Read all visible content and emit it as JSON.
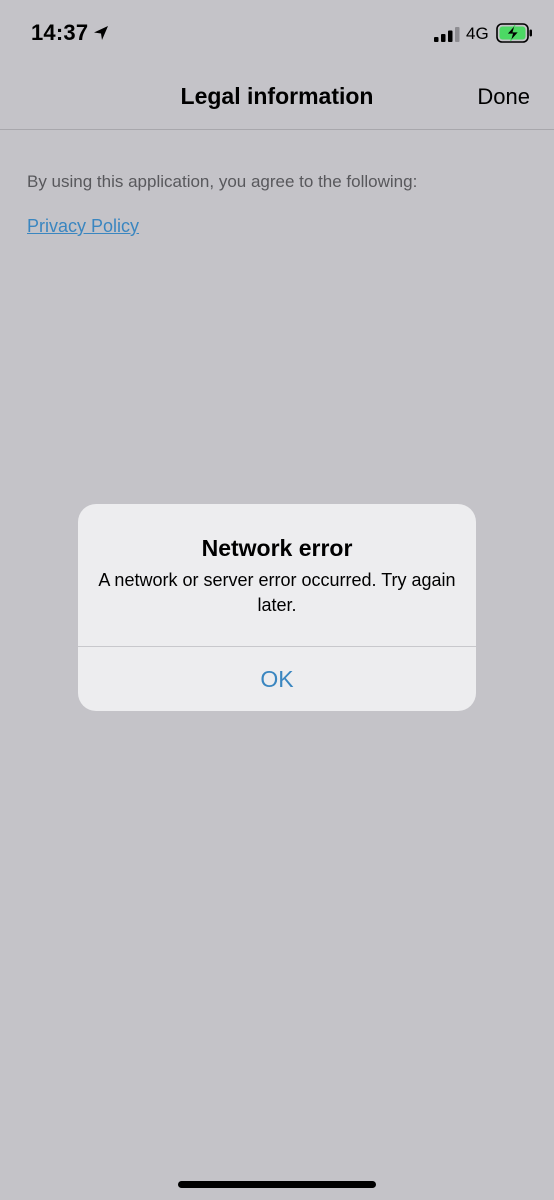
{
  "status_bar": {
    "time": "14:37",
    "network": "4G",
    "icons": [
      "location-arrow-icon",
      "signal-icon",
      "battery-charging-icon"
    ]
  },
  "nav": {
    "title": "Legal information",
    "done_label": "Done"
  },
  "content": {
    "intro": "By using this application, you agree to the following:",
    "privacy_link": "Privacy Policy"
  },
  "alert": {
    "title": "Network error",
    "message": "A network or server error occurred. Try again later.",
    "ok_label": "OK"
  },
  "colors": {
    "background": "#c4c3c8",
    "link": "#3a86c0",
    "alert_bg": "#ededef",
    "battery_charge": "#4cd964"
  }
}
